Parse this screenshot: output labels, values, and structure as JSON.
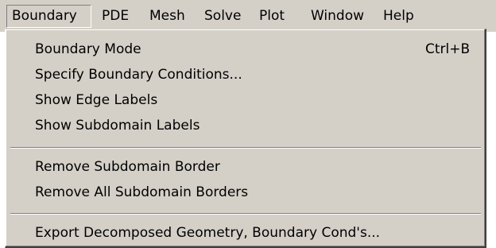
{
  "menubar": {
    "items": [
      {
        "label": "Boundary"
      },
      {
        "label": "PDE"
      },
      {
        "label": "Mesh"
      },
      {
        "label": "Solve"
      },
      {
        "label": "Plot"
      },
      {
        "label": "Window"
      },
      {
        "label": "Help"
      }
    ]
  },
  "boundary_menu": {
    "items": [
      {
        "label": "Boundary Mode",
        "shortcut": "Ctrl+B"
      },
      {
        "label": "Specify Boundary Conditions..."
      },
      {
        "label": "Show Edge Labels"
      },
      {
        "label": "Show Subdomain Labels"
      },
      {
        "label": "Remove Subdomain Border"
      },
      {
        "label": "Remove All Subdomain Borders"
      },
      {
        "label": "Export Decomposed Geometry, Boundary Cond's..."
      }
    ]
  }
}
